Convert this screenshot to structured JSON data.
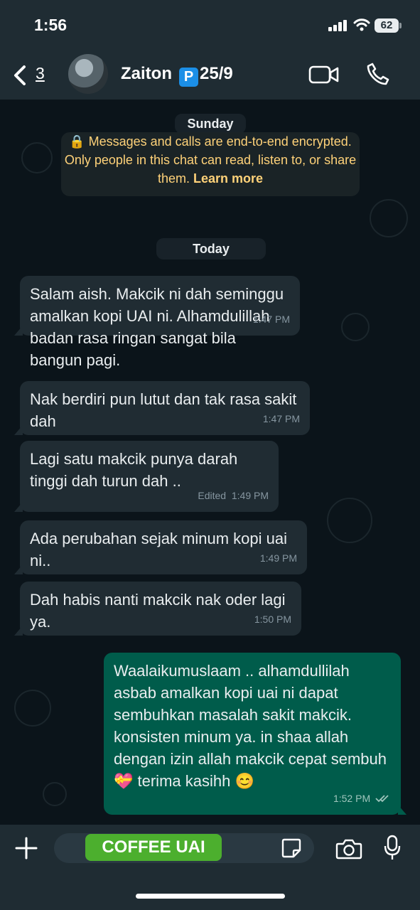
{
  "status_bar": {
    "time": "1:56",
    "battery": "62"
  },
  "header": {
    "back_count": "3",
    "contact_name": "Zaiton",
    "badge_letter": "P",
    "contact_suffix": "25/9"
  },
  "chat": {
    "day_1": "Sunday",
    "encryption_notice": "Messages and calls are end-to-end encrypted. Only people in this chat can read, listen to, or share them.",
    "learn_more": "Learn more",
    "day_2": "Today",
    "messages": [
      {
        "direction": "in",
        "text": "Salam aish. Makcik ni dah seminggu amalkan kopi UAI ni. Alhamdulillah badan rasa ringan sangat bila bangun pagi.",
        "time": "1:47 PM"
      },
      {
        "direction": "in",
        "text": "Nak berdiri pun lutut dan tak rasa sakit dah",
        "time": "1:47 PM"
      },
      {
        "direction": "in",
        "text": "Lagi satu makcik punya darah tinggi dah turun dah ..",
        "time": "1:49 PM",
        "edited": "Edited"
      },
      {
        "direction": "in",
        "text": "Ada perubahan sejak minum kopi uai ni..",
        "time": "1:49 PM"
      },
      {
        "direction": "in",
        "text": "Dah habis nanti makcik nak oder lagi ya.",
        "time": "1:50 PM"
      },
      {
        "direction": "out",
        "text": "Waalaikumuslaam .. alhamdullilah asbab amalkan kopi  uai ni dapat sembuhkan masalah sakit makcik. konsisten minum ya. in shaa allah dengan izin allah makcik cepat sembuh 💝 terima kasihh 😊",
        "time": "1:52 PM"
      }
    ]
  },
  "input_bar": {
    "overlay_label": "COFFEE UAI"
  },
  "colors": {
    "incoming_bubble": "#202c33",
    "outgoing_bubble": "#005c4b",
    "system_text": "#ffd279",
    "overlay_green": "#4caf2e"
  }
}
